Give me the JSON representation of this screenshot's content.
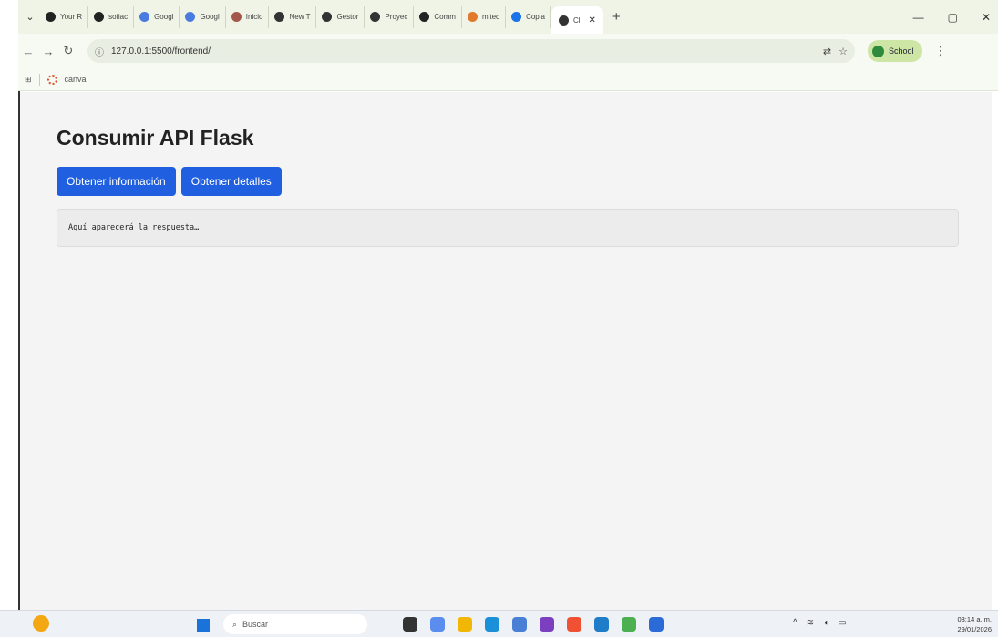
{
  "browser": {
    "tabs": [
      {
        "label": "Your R",
        "color": "#222222",
        "icon": "github-icon"
      },
      {
        "label": "sofiac",
        "color": "#222222",
        "icon": "github-icon"
      },
      {
        "label": "Googl",
        "color": "#4a7be0",
        "icon": "gemini-icon"
      },
      {
        "label": "Googl",
        "color": "#4a7be0",
        "icon": "gemini-icon"
      },
      {
        "label": "Inicio",
        "color": "#a3584b",
        "icon": "site-icon"
      },
      {
        "label": "New T",
        "color": "#333333",
        "icon": "chatgpt-icon"
      },
      {
        "label": "Gestor",
        "color": "#333333",
        "icon": "chatgpt-icon"
      },
      {
        "label": "Proyec",
        "color": "#333333",
        "icon": "globe-icon"
      },
      {
        "label": "Comm",
        "color": "#222222",
        "icon": "github-icon"
      },
      {
        "label": "mitec",
        "color": "#e07b2b",
        "icon": "chart-icon"
      },
      {
        "label": "Copia",
        "color": "#1a73e8",
        "icon": "colab-icon"
      }
    ],
    "active_tab": {
      "label": "Cl",
      "color": "#333333",
      "icon": "chatgpt-icon"
    },
    "url": "127.0.0.1:5500/frontend/",
    "profile_label": "School",
    "bookmarks": [
      {
        "label": "canva"
      }
    ]
  },
  "page": {
    "title": "Consumir API Flask",
    "buttons": {
      "info": "Obtener información",
      "details": "Obtener detalles"
    },
    "response_text": "Aquí aparecerá la respuesta…",
    "accent_color": "#1f5fe0"
  },
  "taskbar": {
    "search_placeholder": "Buscar",
    "time": "03:14 a. m.",
    "date": "29/01/2026",
    "apps": [
      "file-explorer-icon",
      "copilot-icon",
      "folder-icon",
      "edge-icon",
      "teams-icon",
      "github-desktop-icon",
      "git-icon",
      "vscode-icon",
      "chrome-icon",
      "app-icon"
    ]
  }
}
